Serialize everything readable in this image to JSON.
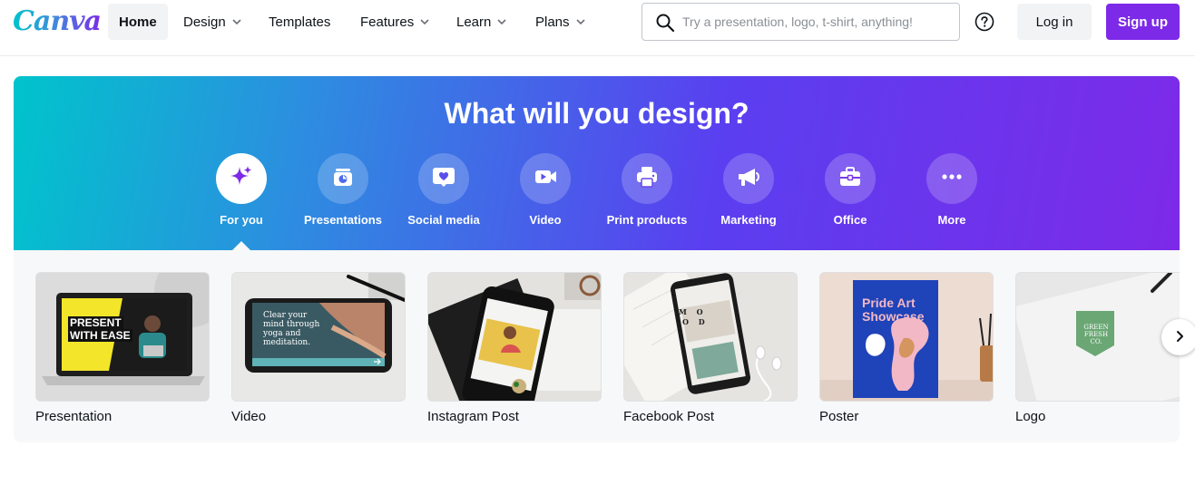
{
  "brand": {
    "logo_text": "Canva",
    "primary": "#7d2ae8",
    "accent": "#00c4cc"
  },
  "nav": {
    "items": [
      {
        "label": "Home",
        "active": true,
        "has_dropdown": false
      },
      {
        "label": "Design",
        "active": false,
        "has_dropdown": true
      },
      {
        "label": "Templates",
        "active": false,
        "has_dropdown": false
      },
      {
        "label": "Features",
        "active": false,
        "has_dropdown": true
      },
      {
        "label": "Learn",
        "active": false,
        "has_dropdown": true
      },
      {
        "label": "Plans",
        "active": false,
        "has_dropdown": true
      }
    ],
    "search_placeholder": "Try a presentation, logo, t-shirt, anything!",
    "search_value": "",
    "help_icon": "question-circle-icon",
    "login_label": "Log in",
    "signup_label": "Sign up"
  },
  "hero": {
    "title": "What will you design?",
    "categories": [
      {
        "label": "For you",
        "icon": "sparkle-icon",
        "active": true
      },
      {
        "label": "Presentations",
        "icon": "presentation-icon",
        "active": false
      },
      {
        "label": "Social media",
        "icon": "heart-chat-icon",
        "active": false
      },
      {
        "label": "Video",
        "icon": "video-camera-icon",
        "active": false
      },
      {
        "label": "Print products",
        "icon": "printer-icon",
        "active": false
      },
      {
        "label": "Marketing",
        "icon": "megaphone-icon",
        "active": false
      },
      {
        "label": "Office",
        "icon": "briefcase-icon",
        "active": false
      },
      {
        "label": "More",
        "icon": "more-dots-icon",
        "active": false
      }
    ]
  },
  "templates": {
    "cards": [
      {
        "label": "Presentation",
        "thumb_text": [
          "PRESENT",
          "WITH EASE"
        ]
      },
      {
        "label": "Video",
        "thumb_text": [
          "Clear your",
          "mind through",
          "yoga and",
          "meditation."
        ]
      },
      {
        "label": "Instagram Post",
        "thumb_text": []
      },
      {
        "label": "Facebook Post",
        "thumb_text": [
          "M",
          "O",
          "O",
          "D"
        ]
      },
      {
        "label": "Poster",
        "thumb_text": [
          "Pride Art",
          "Showcase"
        ]
      },
      {
        "label": "Logo",
        "thumb_text": [
          "GREEN",
          "FRESH CO."
        ]
      }
    ],
    "next_icon": "chevron-right-icon"
  }
}
